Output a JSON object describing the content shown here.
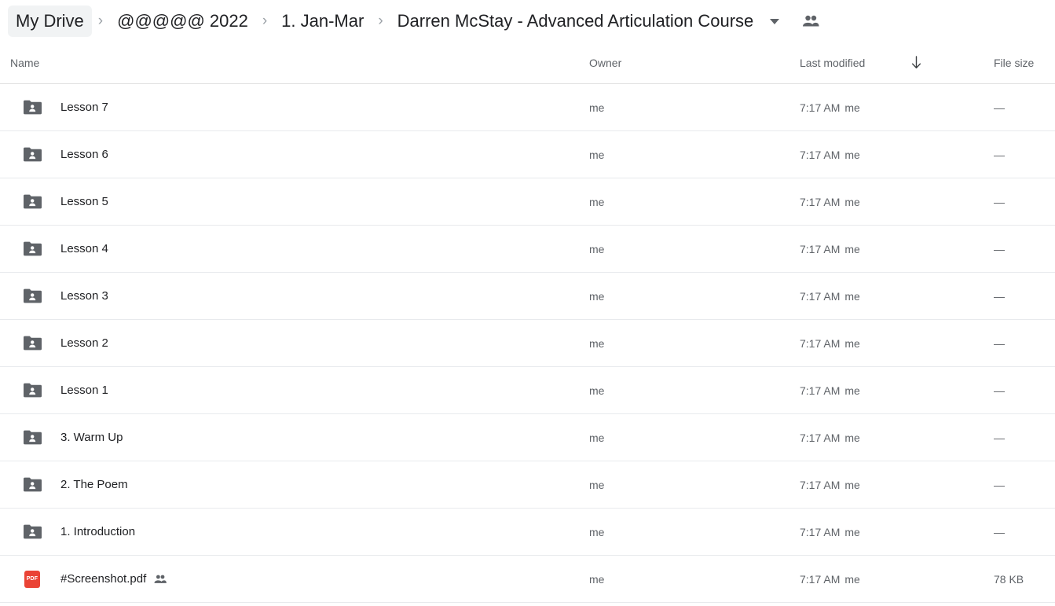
{
  "breadcrumb": {
    "items": [
      {
        "label": "My Drive",
        "root": true
      },
      {
        "label": "@@@@@ 2022",
        "root": false
      },
      {
        "label": "1. Jan-Mar",
        "root": false
      },
      {
        "label": "Darren McStay - Advanced Articulation Course",
        "root": false,
        "current": true
      }
    ],
    "separator": "›",
    "caret_icon": "chevron-down-icon",
    "share_icon": "people-shared-icon"
  },
  "columns": {
    "name": "Name",
    "owner": "Owner",
    "last_modified": "Last modified",
    "file_size": "File size",
    "sort_icon": "arrow-down-icon",
    "sort_direction": "descending"
  },
  "colors": {
    "folder": "#5f6368",
    "pdf": "#ea4335",
    "text_primary": "#202124",
    "text_secondary": "#5f6368",
    "chip_background": "#f1f3f4",
    "divider": "#e8eaed"
  },
  "rows": [
    {
      "icon": "shared-folder-icon",
      "name": "Lesson 7",
      "shared": false,
      "owner": "me",
      "modified_time": "7:17 AM",
      "modified_by": "me",
      "size": "—"
    },
    {
      "icon": "shared-folder-icon",
      "name": "Lesson 6",
      "shared": false,
      "owner": "me",
      "modified_time": "7:17 AM",
      "modified_by": "me",
      "size": "—"
    },
    {
      "icon": "shared-folder-icon",
      "name": "Lesson 5",
      "shared": false,
      "owner": "me",
      "modified_time": "7:17 AM",
      "modified_by": "me",
      "size": "—"
    },
    {
      "icon": "shared-folder-icon",
      "name": "Lesson 4",
      "shared": false,
      "owner": "me",
      "modified_time": "7:17 AM",
      "modified_by": "me",
      "size": "—"
    },
    {
      "icon": "shared-folder-icon",
      "name": "Lesson 3",
      "shared": false,
      "owner": "me",
      "modified_time": "7:17 AM",
      "modified_by": "me",
      "size": "—"
    },
    {
      "icon": "shared-folder-icon",
      "name": "Lesson 2",
      "shared": false,
      "owner": "me",
      "modified_time": "7:17 AM",
      "modified_by": "me",
      "size": "—"
    },
    {
      "icon": "shared-folder-icon",
      "name": "Lesson 1",
      "shared": false,
      "owner": "me",
      "modified_time": "7:17 AM",
      "modified_by": "me",
      "size": "—"
    },
    {
      "icon": "shared-folder-icon",
      "name": "3. Warm Up",
      "shared": false,
      "owner": "me",
      "modified_time": "7:17 AM",
      "modified_by": "me",
      "size": "—"
    },
    {
      "icon": "shared-folder-icon",
      "name": "2. The Poem",
      "shared": false,
      "owner": "me",
      "modified_time": "7:17 AM",
      "modified_by": "me",
      "size": "—"
    },
    {
      "icon": "shared-folder-icon",
      "name": "1. Introduction",
      "shared": false,
      "owner": "me",
      "modified_time": "7:17 AM",
      "modified_by": "me",
      "size": "—"
    },
    {
      "icon": "pdf-file-icon",
      "name": "#Screenshot.pdf",
      "shared": true,
      "owner": "me",
      "modified_time": "7:17 AM",
      "modified_by": "me",
      "size": "78 KB",
      "pdf_label": "PDF"
    }
  ]
}
